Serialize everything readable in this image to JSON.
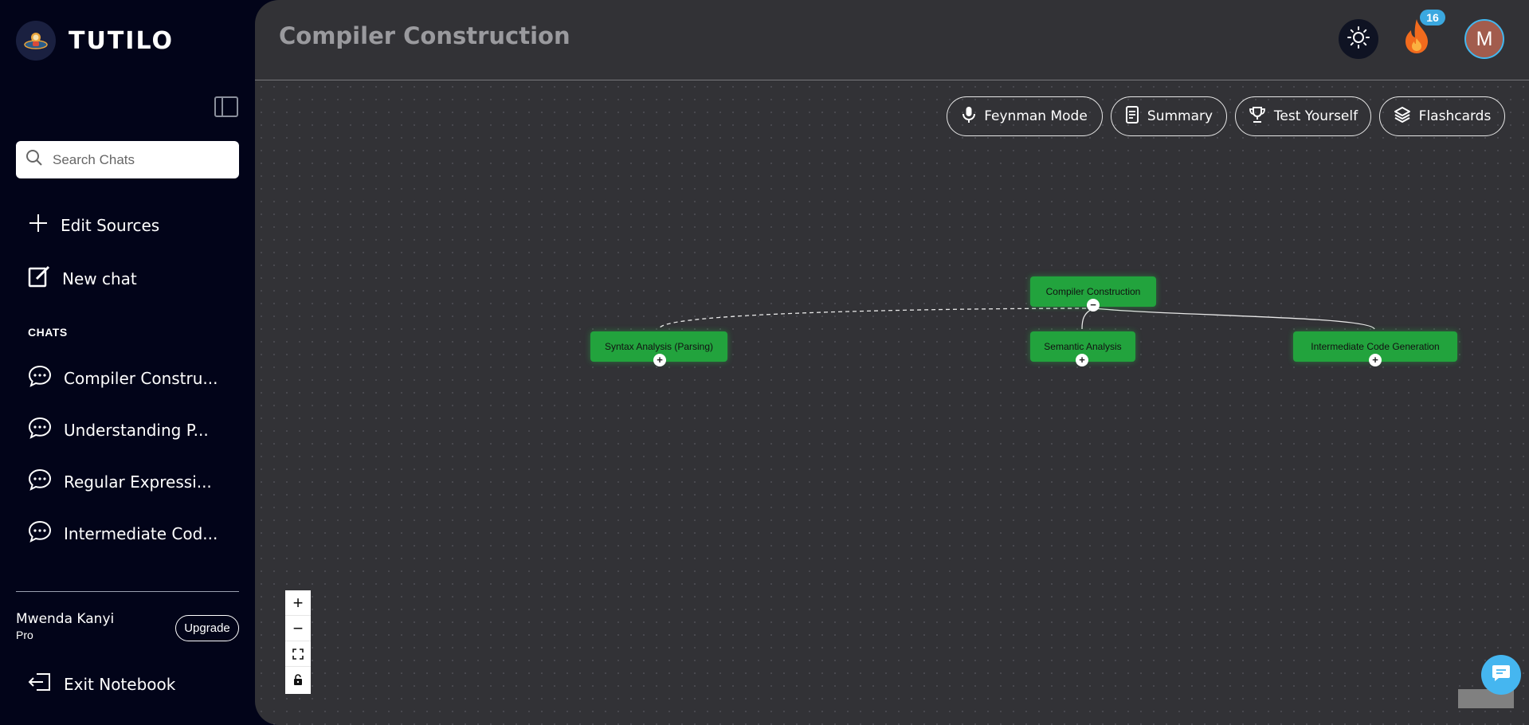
{
  "brand": {
    "name": "TUTILO",
    "logo_icon": "astronaut-logo-icon"
  },
  "sidebar": {
    "search_placeholder": "Search Chats",
    "edit_sources": "Edit Sources",
    "new_chat": "New chat",
    "chats_heading": "CHATS",
    "chats": [
      {
        "label": "Compiler Constru..."
      },
      {
        "label": "Understanding P..."
      },
      {
        "label": "Regular Expressi..."
      },
      {
        "label": "Intermediate Cod..."
      }
    ],
    "user_name": "Mwenda Kanyi",
    "user_plan": "Pro",
    "upgrade_label": "Upgrade",
    "exit_label": "Exit Notebook"
  },
  "header": {
    "title": "Compiler Construction",
    "streak_count": "16",
    "avatar_initial": "M"
  },
  "toolbar": {
    "feynman": "Feynman Mode",
    "summary": "Summary",
    "test": "Test Yourself",
    "flashcards": "Flashcards"
  },
  "mindmap": {
    "root": {
      "label": "Compiler Construction",
      "toggle": "−"
    },
    "children": [
      {
        "label": "Syntax Analysis (Parsing)",
        "toggle": "+"
      },
      {
        "label": "Semantic Analysis",
        "toggle": "+"
      },
      {
        "label": "Intermediate Code Generation",
        "toggle": "+"
      }
    ]
  },
  "zoom_controls": {
    "zoom_in": "+",
    "zoom_out": "−"
  },
  "colors": {
    "sidebar_bg": "#020419",
    "main_bg": "#323236",
    "node_green": "#22a33d",
    "accent_blue": "#45b6f0",
    "streak_orange": "#f26b1d"
  }
}
